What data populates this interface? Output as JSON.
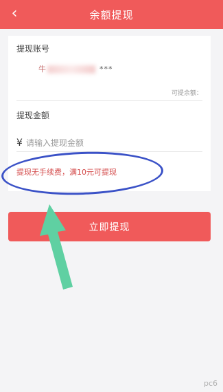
{
  "header": {
    "back_icon": "‹",
    "title": "余额提现"
  },
  "account_section": {
    "label": "提现账号",
    "account_visible_prefix": "牛",
    "account_masked": "***",
    "available_label": "可提余额："
  },
  "amount_section": {
    "label": "提现金额",
    "currency_symbol": "¥",
    "placeholder": "请输入提现金额",
    "value": ""
  },
  "notice": "提现无手续费，满10元可提现",
  "submit_label": "立即提现",
  "annotation": {
    "circle_color": "#3b52c7",
    "arrow_color": "#5fd0a2"
  },
  "watermark": "pc6",
  "colors": {
    "accent": "#f05a5a",
    "notice_text": "#d34848",
    "background": "#f4f4f6"
  }
}
